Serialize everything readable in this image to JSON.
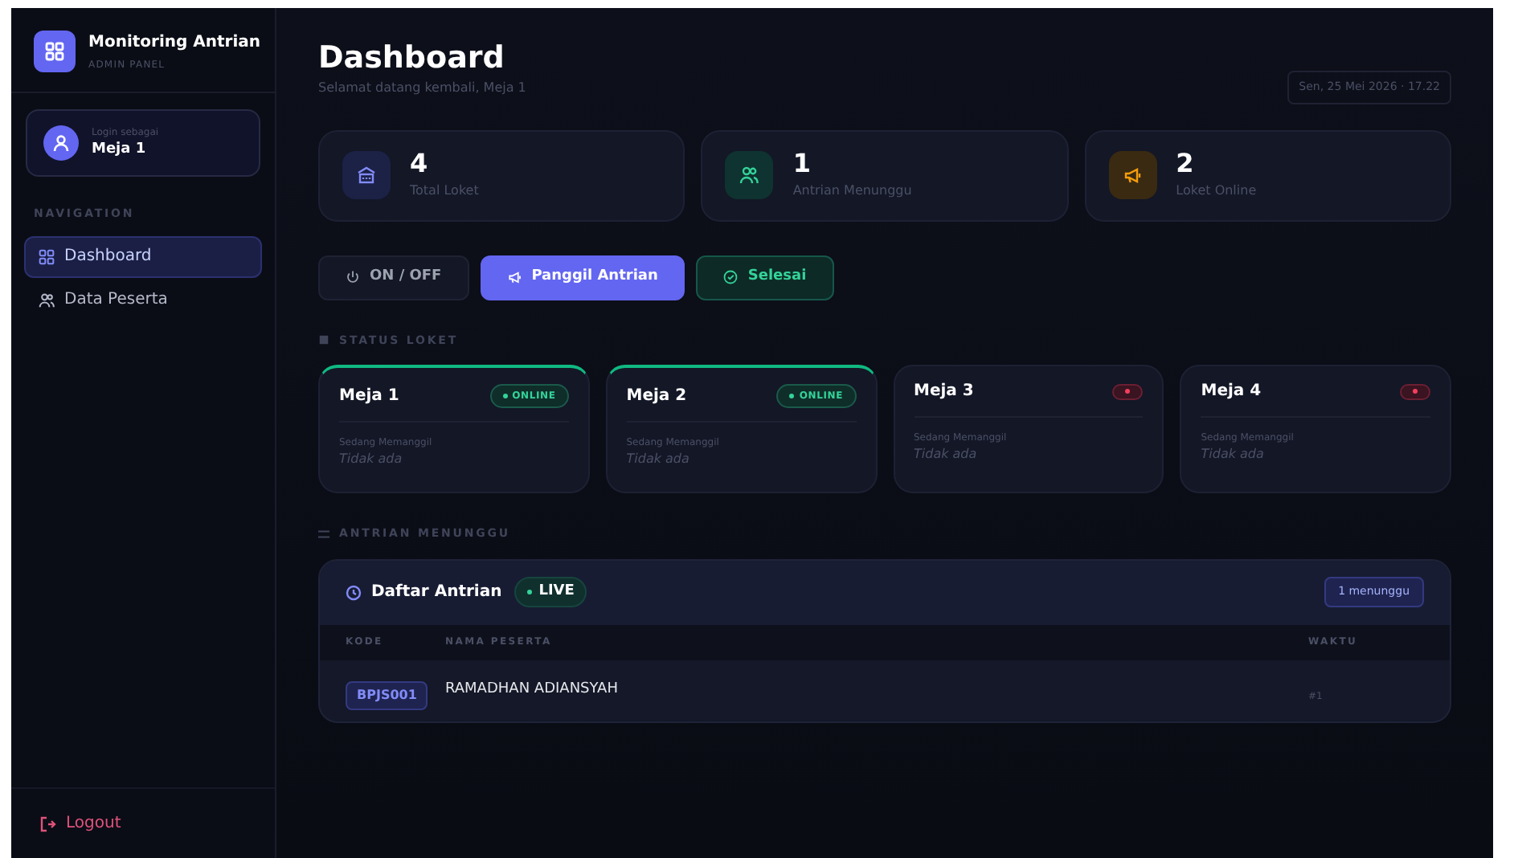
{
  "sidebar": {
    "app_title": "Monitoring Antrian",
    "app_subtitle": "ADMIN PANEL",
    "user": {
      "caption": "Login sebagai",
      "name": "Meja 1"
    },
    "nav_heading": "NAVIGATION",
    "nav_items": [
      {
        "label": "Dashboard",
        "kind": "grid",
        "selected": true
      },
      {
        "label": "Data Peserta",
        "kind": "users",
        "selected": false
      }
    ],
    "logout": "Logout"
  },
  "header": {
    "title": "Dashboard",
    "subtitle": "Selamat datang kembali, Meja 1",
    "datetime": "Sen, 25 Mei 2026 · 17.22"
  },
  "stats": [
    {
      "kind": "bank",
      "value": "4",
      "label": "Total Loket"
    },
    {
      "kind": "users",
      "value": "1",
      "label": "Antrian Menunggu"
    },
    {
      "kind": "megaphone",
      "value": "2",
      "label": "Loket Online"
    }
  ],
  "actions": [
    {
      "kind": "power",
      "label": "ON / OFF"
    },
    {
      "kind": "megaphone",
      "label": "Panggil Antrian"
    },
    {
      "kind": "check",
      "label": "Selesai"
    }
  ],
  "status_heading": "STATUS LOKET",
  "counters": [
    {
      "name": "Meja 1",
      "online": true,
      "badge": "ONLINE",
      "caption": "Sedang Memanggil",
      "value": "Tidak ada"
    },
    {
      "name": "Meja 2",
      "online": true,
      "badge": "ONLINE",
      "caption": "Sedang Memanggil",
      "value": "Tidak ada"
    },
    {
      "name": "Meja 3",
      "online": false,
      "caption": "Sedang Memanggil",
      "value": "Tidak ada"
    },
    {
      "name": "Meja 4",
      "online": false,
      "caption": "Sedang Memanggil",
      "value": "Tidak ada"
    }
  ],
  "queue_heading": "ANTRIAN MENUNGGU",
  "queue": {
    "title": "Daftar Antrian",
    "live": "LIVE",
    "count": "1 menunggu",
    "columns": [
      "KODE",
      "NAMA PESERTA",
      "WAKTU"
    ],
    "rows": [
      {
        "code": "BPJS001",
        "name": "RAMADHAN ADIANSYAH",
        "time": "#1"
      }
    ]
  }
}
